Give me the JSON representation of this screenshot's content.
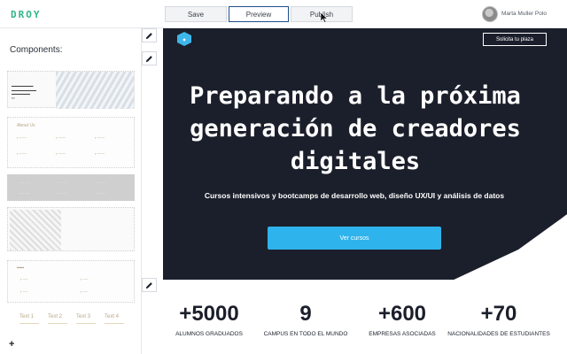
{
  "topbar": {
    "logo": "DROY",
    "tabs": [
      "Save",
      "Preview",
      "Publish"
    ],
    "active_tab": "Preview",
    "user_name": "Marta Muller Polo"
  },
  "sidebar": {
    "title": "Components:",
    "about_title": "About Us",
    "plus": "+",
    "footer_labels": [
      "Text 1",
      "Text 2",
      "Text 3",
      "Text 4"
    ]
  },
  "hero": {
    "cta_top": "Solicita tu plaza",
    "title": "Preparando a la próxima generación de creadores digitales",
    "subtitle": "Cursos intensivos y bootcamps de desarrollo web, diseño UX/UI y análisis de datos",
    "button": "Ver cursos"
  },
  "stats": [
    {
      "number": "+5000",
      "label": "ALUMNOS GRADUADOS"
    },
    {
      "number": "9",
      "label": "CAMPUS EN TODO EL MUNDO"
    },
    {
      "number": "+600",
      "label": "EMPRESAS ASOCIADAS"
    },
    {
      "number": "+70",
      "label": "NACIONALIDADES DE ESTUDIANTES"
    }
  ],
  "colors": {
    "accent": "#2fb3ec",
    "brand_green": "#2fb58a",
    "hero_bg": "#1b1f2b"
  },
  "icons": {
    "edit": "pencil-icon",
    "add": "plus-icon",
    "cursor": "mouse-pointer-icon"
  }
}
